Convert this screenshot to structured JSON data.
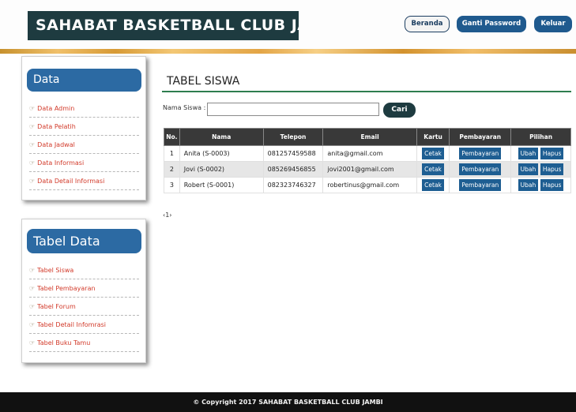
{
  "header": {
    "brand": "SAHABAT BASKETBALL CLUB JAMBI",
    "nav": {
      "home": "Beranda",
      "change_password": "Ganti Password",
      "logout": "Keluar"
    }
  },
  "sidebar": {
    "data_title": "Data",
    "data_items": [
      "Data Admin",
      "Data Pelatih",
      "Data Jadwal",
      "Data Informasi",
      "Data Detail Informasi"
    ],
    "table_title": "Tabel Data",
    "table_items": [
      "Tabel Siswa",
      "Tabel Pembayaran",
      "Tabel Forum",
      "Tabel Detail Infomrasi",
      "Tabel Buku Tamu"
    ],
    "item_icon": "hand-pointing-icon"
  },
  "main": {
    "title": "TABEL SISWA",
    "search": {
      "label": "Nama Siswa :",
      "value": "",
      "button": "Cari"
    },
    "columns": [
      "No.",
      "Nama",
      "Telepon",
      "Email",
      "Kartu",
      "Pembayaran",
      "Pilihan"
    ],
    "rows": [
      {
        "no": "1",
        "nama": "Anita (S-0003)",
        "telepon": "081257459588",
        "email": "anita@gmail.com"
      },
      {
        "no": "2",
        "nama": "Jovi (S-0002)",
        "telepon": "085269456855",
        "email": "jovi2001@gmail.com"
      },
      {
        "no": "3",
        "nama": "Robert (S-0001)",
        "telepon": "082323746327",
        "email": "robertinus@gmail.com"
      }
    ],
    "row_actions": {
      "card": "Cetak",
      "payment": "Pembayaran",
      "edit": "Ubah",
      "delete": "Hapus"
    },
    "pagination": "‹1›"
  },
  "footer": {
    "text": "© Copyright 2017 SAHABAT BASKETBALL CLUB JAMBI"
  },
  "colors": {
    "brand": "#1e3b40",
    "accent": "#1f5a8e",
    "sidebar_link": "#d23a2a",
    "table_header": "#393939"
  }
}
